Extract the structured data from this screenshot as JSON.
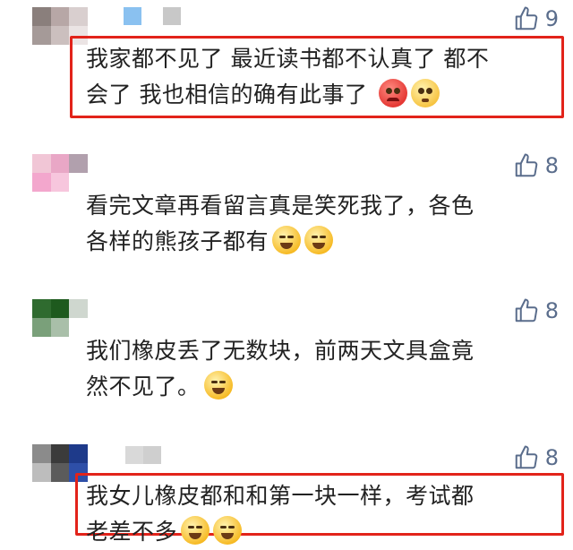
{
  "comments": [
    {
      "likes": "9",
      "lines": [
        "我家都不见了 最近读书都不认真了 都不",
        "会了 我也相信的确有此事了"
      ],
      "emojis": [
        "angry-face-emoji",
        "flushed-face-emoji"
      ],
      "highlighted": true
    },
    {
      "likes": "8",
      "lines": [
        "看完文章再看留言真是笑死我了，各色",
        "各样的熊孩子都有"
      ],
      "emojis": [
        "laughing-crying-emoji",
        "laughing-crying-emoji"
      ],
      "highlighted": false
    },
    {
      "likes": "8",
      "lines": [
        "我们橡皮丢了无数块，前两天文具盒竟",
        "然不见了。"
      ],
      "emojis": [
        "laughing-crying-emoji"
      ],
      "highlighted": false
    },
    {
      "likes": "8",
      "lines": [
        "我女儿橡皮都和和第一块一样，考试都",
        "老差不多"
      ],
      "emojis": [
        "laughing-crying-emoji",
        "laughing-crying-emoji"
      ],
      "highlighted": true
    }
  ],
  "colors": {
    "highlight_border": "#e2231a",
    "like_icon": "#5a6d8c",
    "text": "#222222"
  },
  "icons": {
    "like": "thumbs-up-outline-icon"
  }
}
